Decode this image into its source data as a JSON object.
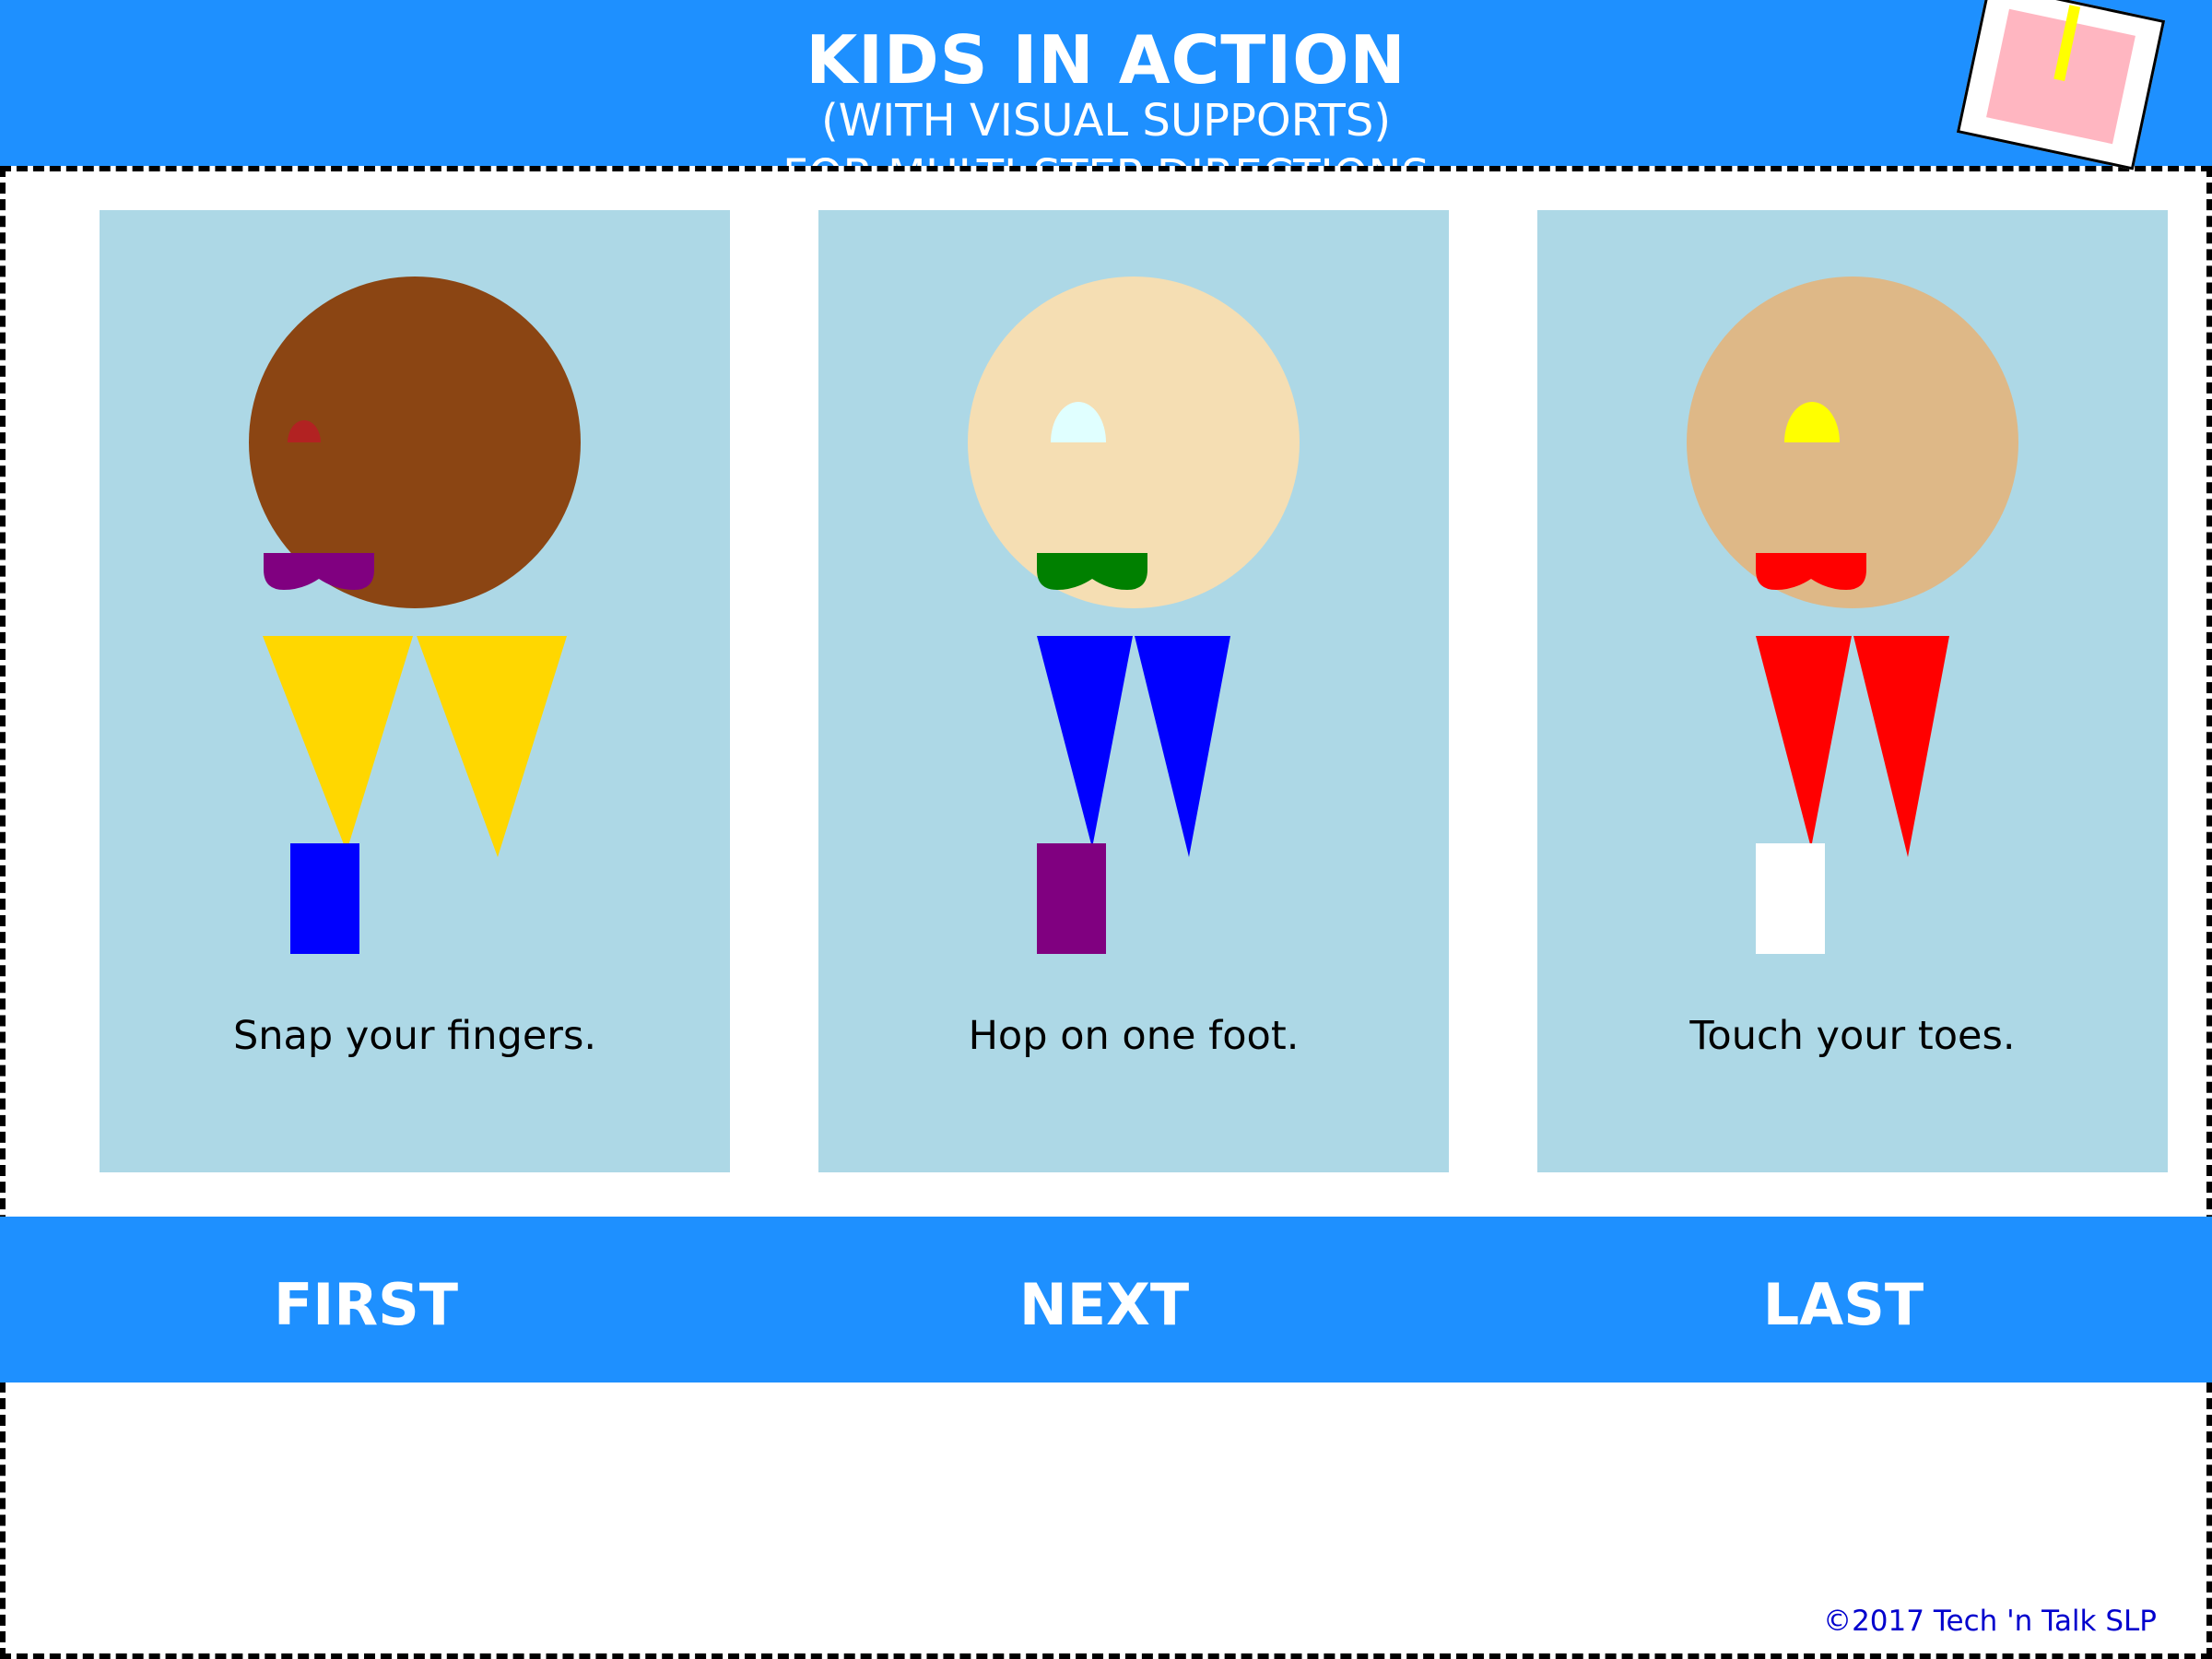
{
  "header": {
    "title": "KIDS IN ACTION",
    "subtitle": "(WITH VISUAL SUPPORTS)",
    "subtitle2": "FOR MULTI-STEP DIRECTIONS",
    "background_color": "#1E90FF"
  },
  "badge": {
    "icon": "note-card-icon",
    "colors": {
      "card": "#FFB6C1",
      "stick": "#FFFF00"
    }
  },
  "cards": [
    {
      "caption": "Snap your fingers.",
      "colors": {
        "head": "#8B4513",
        "eye": "#B22222",
        "mouth": "#800080",
        "legs": "#FFD700",
        "shoe": "#0000FF"
      }
    },
    {
      "caption": "Hop on one foot.",
      "colors": {
        "head": "#F5DEB3",
        "eye": "#E0FFFF",
        "mouth": "#008000",
        "legs": "#0000FF",
        "shoe": "#800080"
      }
    },
    {
      "caption": "Touch your toes.",
      "colors": {
        "head": "#DEB887",
        "eye": "#FFFF00",
        "mouth": "#FF0000",
        "legs": "#FF0000",
        "shoe": "#FFFFFF"
      }
    }
  ],
  "steps": {
    "first": "FIRST",
    "next": "NEXT",
    "last": "LAST"
  },
  "footer": {
    "copyright": "©2017 Tech 'n Talk SLP"
  }
}
